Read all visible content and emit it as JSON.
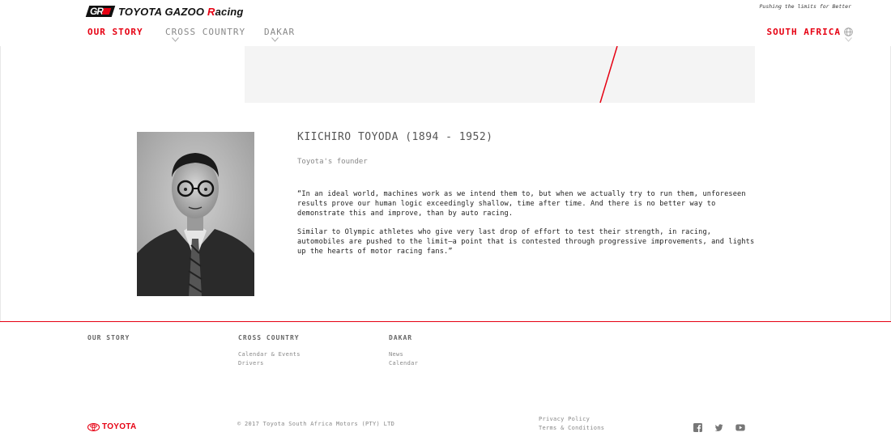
{
  "header": {
    "brand_parts": [
      "TOYOTA GAZOO ",
      "R",
      "acing"
    ],
    "gr_mark": "GR",
    "tagline": "Pushing the limits for Better",
    "nav": [
      {
        "label": "OUR STORY",
        "active": true
      },
      {
        "label": "CROSS COUNTRY",
        "has_dropdown": true
      },
      {
        "label": "DAKAR",
        "has_dropdown": true
      }
    ],
    "region": {
      "label": "SOUTH AFRICA",
      "icon": "globe-icon"
    }
  },
  "bio": {
    "name": "KIICHIRO TOYODA (1894 - 1952)",
    "role": "Toyota's founder",
    "paragraphs": [
      "“In an ideal world, machines work as we intend them to, but when we actually try to run them, unforeseen results prove our human logic exceedingly shallow, time after time. And there is no better way to demonstrate this and improve, than by auto racing.",
      "Similar to Olympic athletes who give very last drop of effort to test their strength, in racing, automobiles are pushed to the limit—a point that is contested through progressive improvements, and lights up the hearts of motor racing fans.”"
    ]
  },
  "footer": {
    "columns": [
      {
        "title": "OUR STORY",
        "links": []
      },
      {
        "title": "CROSS COUNTRY",
        "links": [
          "Calendar & Events",
          "Drivers"
        ]
      },
      {
        "title": "DAKAR",
        "links": [
          "News",
          "Calendar"
        ]
      }
    ],
    "brand": "TOYOTA",
    "copyright": "© 2017 Toyota South Africa Motors (PTY) LTD",
    "legal_links": [
      "Privacy Policy",
      "Terms & Conditions"
    ],
    "social": [
      "facebook-icon",
      "twitter-icon",
      "youtube-icon"
    ]
  },
  "colors": {
    "accent": "#e60012",
    "text": "#333333",
    "muted": "#888888",
    "banner_bg": "#f4f4f4"
  }
}
